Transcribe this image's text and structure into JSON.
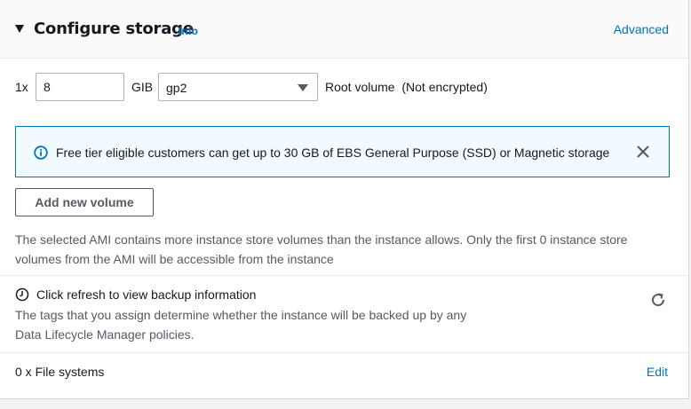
{
  "header": {
    "title": "Configure storage",
    "info_label": "Info",
    "advanced_label": "Advanced"
  },
  "volume": {
    "quantity_label": "1x",
    "size_value": "8",
    "unit_label": "GIB",
    "type_value": "gp2",
    "root_label": "Root volume  (Not encrypted)"
  },
  "alert": {
    "text": "Free tier eligible customers can get up to 30 GB of EBS General Purpose (SSD) or Magnetic storage",
    "icon": "info-icon"
  },
  "add_volume_label": "Add new volume",
  "ami_note": "The selected AMI contains more instance store volumes than the instance allows. Only the first 0 instance store volumes from the AMI will be accessible from the instance",
  "backup": {
    "title": "Click refresh to view backup information",
    "description_line1": "The tags that you assign determine whether the instance will be backed up by any",
    "description_line2": "Data Lifecycle Manager policies."
  },
  "file_systems": {
    "label": "0 x File systems",
    "edit_label": "Edit"
  },
  "colors": {
    "link": "#0073bb",
    "alert_bg": "#f1faff",
    "alert_border": "#0073bb",
    "text": "#16191f",
    "secondary_text": "#545b64"
  }
}
